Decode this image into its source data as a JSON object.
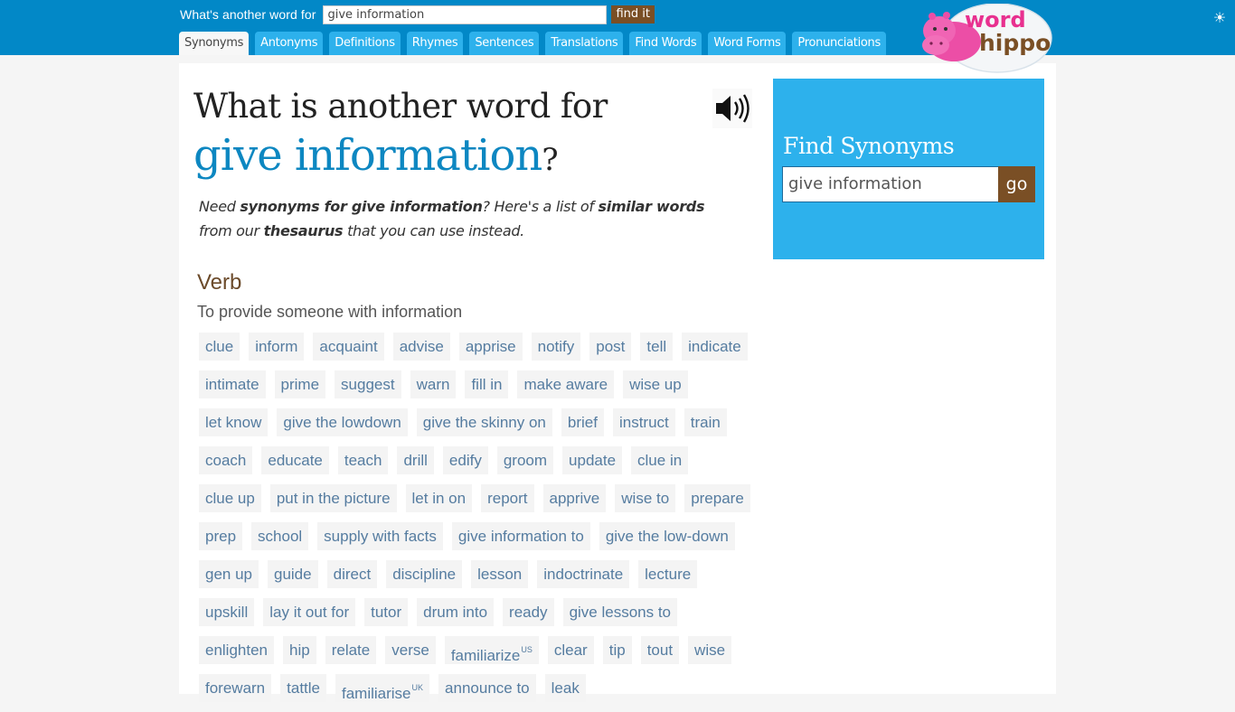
{
  "header": {
    "search_label": "What's another word for",
    "search_value": "give information",
    "find_button": "find it",
    "tabs": [
      {
        "label": "Synonyms",
        "active": true
      },
      {
        "label": "Antonyms"
      },
      {
        "label": "Definitions"
      },
      {
        "label": "Rhymes"
      },
      {
        "label": "Sentences"
      },
      {
        "label": "Translations"
      },
      {
        "label": "Find Words"
      },
      {
        "label": "Word Forms"
      },
      {
        "label": "Pronunciations"
      }
    ],
    "logo_text_top": "word",
    "logo_text_bottom": "hippo",
    "theme_icon": "sun-icon"
  },
  "main": {
    "title_line1": "What is another word for",
    "title_term": "give information",
    "title_q": "?",
    "intro": {
      "p1": "Need ",
      "b1": "synonyms for give information",
      "p2": "? Here's a list of ",
      "b2": "similar words",
      "p3": " from our ",
      "b3": "thesaurus",
      "p4": " that you can use instead."
    },
    "part_of_speech": "Verb",
    "definition": "To provide someone with information",
    "words": [
      {
        "w": "clue"
      },
      {
        "w": "inform"
      },
      {
        "w": "acquaint"
      },
      {
        "w": "advise"
      },
      {
        "w": "apprise"
      },
      {
        "w": "notify"
      },
      {
        "w": "post"
      },
      {
        "w": "tell"
      },
      {
        "w": "indicate"
      },
      {
        "w": "intimate"
      },
      {
        "w": "prime"
      },
      {
        "w": "suggest"
      },
      {
        "w": "warn"
      },
      {
        "w": "fill in"
      },
      {
        "w": "make aware"
      },
      {
        "w": "wise up"
      },
      {
        "w": "let know"
      },
      {
        "w": "give the lowdown"
      },
      {
        "w": "give the skinny on"
      },
      {
        "w": "brief"
      },
      {
        "w": "instruct"
      },
      {
        "w": "train"
      },
      {
        "w": "coach"
      },
      {
        "w": "educate"
      },
      {
        "w": "teach"
      },
      {
        "w": "drill"
      },
      {
        "w": "edify"
      },
      {
        "w": "groom"
      },
      {
        "w": "update"
      },
      {
        "w": "clue in"
      },
      {
        "w": "clue up"
      },
      {
        "w": "put in the picture"
      },
      {
        "w": "let in on"
      },
      {
        "w": "report"
      },
      {
        "w": "apprive"
      },
      {
        "w": "wise to"
      },
      {
        "w": "prepare"
      },
      {
        "w": "prep"
      },
      {
        "w": "school"
      },
      {
        "w": "supply with facts"
      },
      {
        "w": "give information to"
      },
      {
        "w": "give the low-down"
      },
      {
        "w": "gen up"
      },
      {
        "w": "guide"
      },
      {
        "w": "direct"
      },
      {
        "w": "discipline"
      },
      {
        "w": "lesson"
      },
      {
        "w": "indoctrinate"
      },
      {
        "w": "lecture"
      },
      {
        "w": "upskill"
      },
      {
        "w": "lay it out for"
      },
      {
        "w": "tutor"
      },
      {
        "w": "drum into"
      },
      {
        "w": "ready"
      },
      {
        "w": "give lessons to"
      },
      {
        "w": "enlighten"
      },
      {
        "w": "hip"
      },
      {
        "w": "relate"
      },
      {
        "w": "verse"
      },
      {
        "w": "familiarize",
        "sup": "US"
      },
      {
        "w": "clear"
      },
      {
        "w": "tip"
      },
      {
        "w": "tout"
      },
      {
        "w": "wise"
      },
      {
        "w": "forewarn"
      },
      {
        "w": "tattle"
      },
      {
        "w": "familiarise",
        "sup": "UK"
      },
      {
        "w": "announce to"
      },
      {
        "w": "leak"
      }
    ]
  },
  "sidebar": {
    "title": "Find Synonyms",
    "input_value": "give information",
    "go_button": "go"
  },
  "colors": {
    "header_bg": "#0288c7",
    "tab_bg": "#2db1ec",
    "brand_brown": "#7a4f25",
    "term_blue": "#0d87c1",
    "word_text": "#557ca0"
  }
}
